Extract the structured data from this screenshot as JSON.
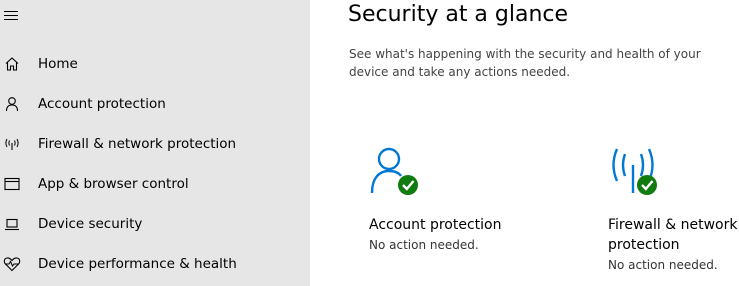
{
  "sidebar": {
    "menu_icon": "hamburger-menu-icon",
    "items": [
      {
        "label": "Home",
        "icon": "home-icon"
      },
      {
        "label": "Account protection",
        "icon": "person-icon"
      },
      {
        "label": "Firewall & network protection",
        "icon": "antenna-icon"
      },
      {
        "label": "App & browser control",
        "icon": "browser-window-icon"
      },
      {
        "label": "Device security",
        "icon": "laptop-icon"
      },
      {
        "label": "Device performance & health",
        "icon": "heart-pulse-icon"
      }
    ]
  },
  "main": {
    "title": "Security at a glance",
    "subtitle": "See what's happening with the security and health of your device and take any actions needed.",
    "cards": [
      {
        "title": "Account protection",
        "status": "No action needed.",
        "icon": "person-check-icon"
      },
      {
        "title": "Firewall & network protection",
        "status": "No action needed.",
        "icon": "antenna-check-icon"
      }
    ]
  },
  "colors": {
    "sidebar_bg": "#e6e6e6",
    "accent_blue": "#0078d4",
    "status_green": "#107c10"
  }
}
